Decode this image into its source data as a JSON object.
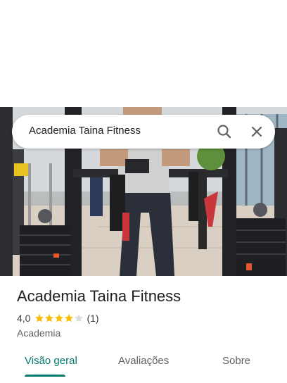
{
  "search": {
    "query": "Academia Taina Fitness",
    "icons": {
      "search": "search-icon",
      "close": "close-icon"
    }
  },
  "place": {
    "name": "Academia Taina Fitness",
    "rating": "4,0",
    "rating_value": 4.0,
    "review_count": "(1)",
    "category": "Academia"
  },
  "tabs": [
    {
      "label": "Visão geral",
      "active": true
    },
    {
      "label": "Avaliações",
      "active": false
    },
    {
      "label": "Sobre",
      "active": false
    }
  ],
  "colors": {
    "accent": "#00796b",
    "star": "#fbbc04",
    "star_empty": "#dadce0"
  }
}
